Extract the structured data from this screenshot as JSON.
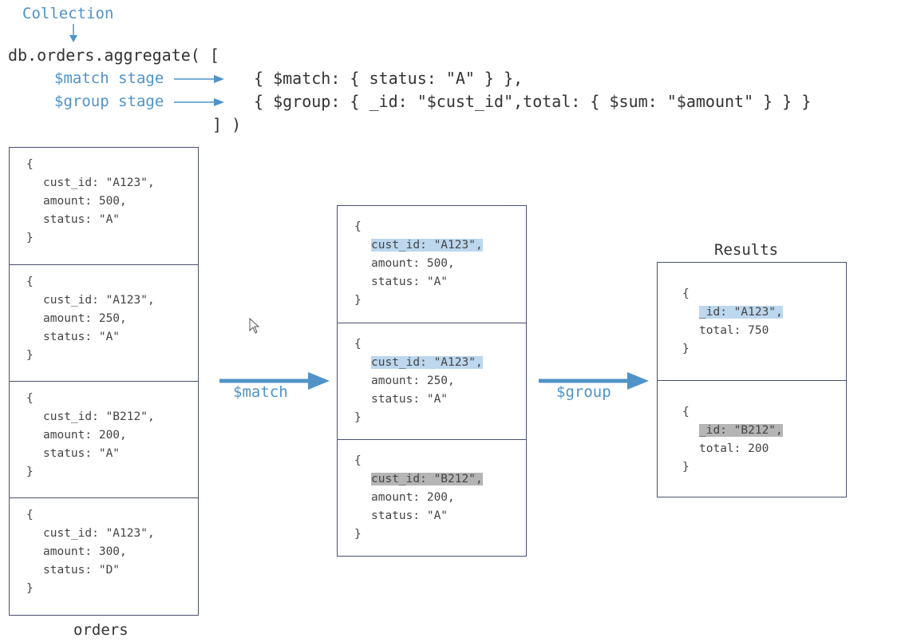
{
  "header": {
    "collection_label": "Collection",
    "code_line1": "db.orders.aggregate( [",
    "match_stage_label": "$match stage",
    "group_stage_label": "$group stage",
    "match_code": "{ $match: { status: \"A\" } },",
    "group_code": "{ $group: { _id: \"$cust_id\",total: { $sum: \"$amount\" } } }",
    "code_close": "] )"
  },
  "colors": {
    "accent": "#4f93c9",
    "highlight_a": "#bcd7ee",
    "highlight_b": "#b5b5b5",
    "border": "#4a5070"
  },
  "orders": {
    "caption": "orders",
    "docs": [
      {
        "open": "{",
        "lines": [
          "cust_id: \"A123\",",
          "amount: 500,",
          "status: \"A\""
        ],
        "close": "}"
      },
      {
        "open": "{",
        "lines": [
          "cust_id: \"A123\",",
          "amount: 250,",
          "status: \"A\""
        ],
        "close": "}"
      },
      {
        "open": "{",
        "lines": [
          "cust_id: \"B212\",",
          "amount: 200,",
          "status: \"A\""
        ],
        "close": "}"
      },
      {
        "open": "{",
        "lines": [
          "cust_id: \"A123\",",
          "amount: 300,",
          "status: \"D\""
        ],
        "close": "}"
      }
    ]
  },
  "match_arrow_label": "$match",
  "matched": {
    "docs": [
      {
        "open": "{",
        "lines": [
          "cust_id: \"A123\",",
          "amount: 500,",
          "status: \"A\""
        ],
        "close": "}",
        "highlight": "blue"
      },
      {
        "open": "{",
        "lines": [
          "cust_id: \"A123\",",
          "amount: 250,",
          "status: \"A\""
        ],
        "close": "}",
        "highlight": "blue"
      },
      {
        "open": "{",
        "lines": [
          "cust_id: \"B212\",",
          "amount: 200,",
          "status: \"A\""
        ],
        "close": "}",
        "highlight": "gray"
      }
    ]
  },
  "group_arrow_label": "$group",
  "results": {
    "caption": "Results",
    "docs": [
      {
        "open": "{",
        "lines": [
          "_id: \"A123\",",
          "total: 750"
        ],
        "close": "}",
        "highlight": "blue"
      },
      {
        "open": "{",
        "lines": [
          "_id: \"B212\",",
          "total: 200"
        ],
        "close": "}",
        "highlight": "gray"
      }
    ]
  }
}
